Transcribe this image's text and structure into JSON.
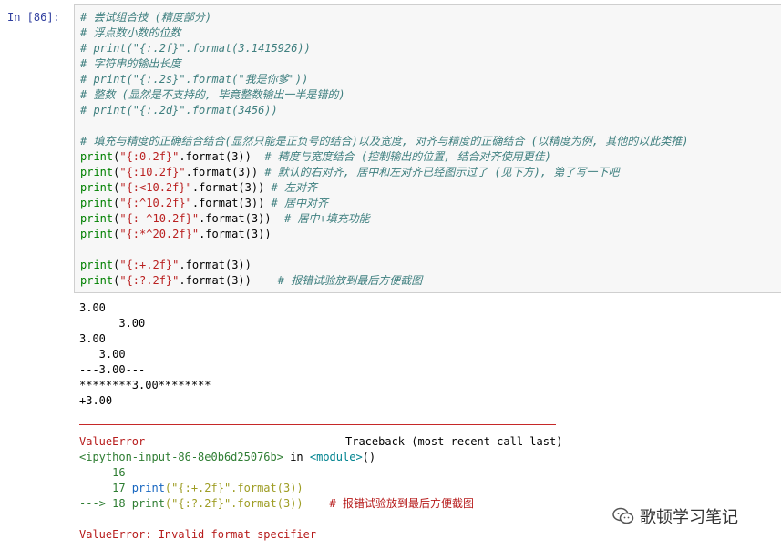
{
  "prompt": "In  [86]:",
  "code": {
    "line1": "# 尝试组合技 (精度部分)",
    "line2": "# 浮点数小数的位数",
    "line3": "# print(\"{:.2f}\".format(3.1415926))",
    "line4": "# 字符串的输出长度",
    "line5": "# print(\"{:.2s}\".format(\"我是你爹\"))",
    "line6": "# 整数 (显然是不支持的, 毕竟整数输出一半是错的)",
    "line7": "# print(\"{:.2d}\".format(3456))",
    "line8": "# 填充与精度的正确结合结合(显然只能是正负号的结合)以及宽度, 对齐与精度的正确结合 (以精度为例, 其他的以此类推)",
    "p1_fmt": "\"{:0.2f}\"",
    "p1_comment": "  # 精度与宽度结合 (控制输出的位置, 结合对齐使用更佳)",
    "p2_fmt": "\"{:10.2f}\"",
    "p2_comment": " # 默认的右对齐, 居中和左对齐已经图示过了 (见下方), 第了写一下吧",
    "p3_fmt": "\"{:<10.2f}\"",
    "p3_comment": " # 左对齐",
    "p4_fmt": "\"{:^10.2f}\"",
    "p4_comment": " # 居中对齐",
    "p5_fmt": "\"{:-^10.2f}\"",
    "p5_comment": "  # 居中+填充功能",
    "p6_fmt": "\"{:*^20.2f}\"",
    "p7_fmt": "\"{:+.2f}\"",
    "p8_fmt": "\"{:?.2f}\"",
    "p8_comment": "    # 报错试验放到最后方便截图",
    "print_kw": "print",
    "paren_open": "(",
    "format_call": ".format(",
    "num_arg": "3",
    "close": "))"
  },
  "output": [
    "3.00",
    "      3.00",
    "3.00",
    "   3.00",
    "---3.00---",
    "********3.00********",
    "+3.00"
  ],
  "traceback": {
    "error_type": "ValueError",
    "header_right": "Traceback (most recent call last)",
    "input_ref": "<ipython-input-86-8e0b6d25076b>",
    "in_text": " in ",
    "module": "<module>",
    "module_suffix": "()",
    "ln16": "     16",
    "ln17": "     17 ",
    "ln17_code_print": "print",
    "ln17_code_str": "(\"{:+.2f}\".format(3))",
    "arrow": "---> 18 ",
    "ln18_code_print": "print",
    "ln18_code_str": "(\"{:?.2f}\".format(3))",
    "ln18_comment": "    # 报错试验放到最后方便截图",
    "final_error": "ValueError: Invalid format specifier"
  },
  "watermark": {
    "text": "歌顿学习笔记",
    "icon": "wechat-icon"
  }
}
